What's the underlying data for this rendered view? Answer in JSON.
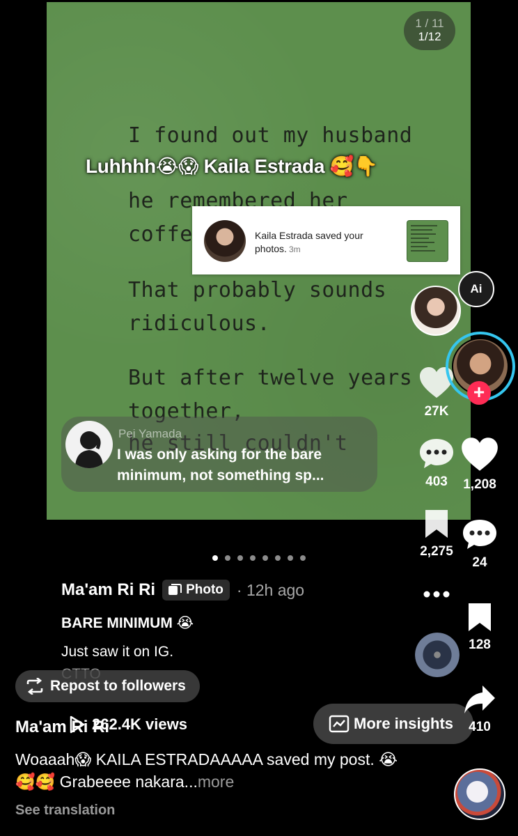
{
  "post": {
    "page_counter_old": "1 / 11",
    "page_counter": "1/12",
    "image_text_lines": [
      "I found out my husband",
      "he remembered her",
      "coffee",
      "That probably sounds",
      "ridiculous.",
      "But after twelve years",
      "together,",
      "he still couldn't"
    ],
    "overlay_caption": "Luhhhh😭😱 Kaila Estrada 🥰👇"
  },
  "notification": {
    "text": "Kaila Estrada saved your photos.",
    "time": "3m"
  },
  "comment_bubble": {
    "author": "Pei Yamada",
    "text": "I was only asking for the bare minimum, not something sp..."
  },
  "carousel": {
    "count": 8,
    "active_index": 0
  },
  "author": {
    "name": "Ma'am Ri Ri",
    "badge": "Photo",
    "time": "· 12h ago"
  },
  "caption": {
    "title": "BARE MINIMUM 😭",
    "line2": "Just saw it on IG.",
    "line3": "CTTO"
  },
  "repost_button": "Repost to followers",
  "views": "262.4K views",
  "insights_button": "More insights",
  "repost_comment": {
    "author": "Ma'am Ri Ri",
    "text": "Woaaah😱 KAILA ESTRADAAAAA saved my post. 😭🥰🥰 Grabeeee nakara...",
    "more": "more",
    "see_translation": "See translation"
  },
  "rail1": {
    "likes": "27K",
    "comments": "403",
    "saves": "2,275"
  },
  "rail2": {
    "likes": "1,208",
    "comments": "24",
    "saves": "128",
    "shares": "410"
  },
  "icons": {
    "ai": "Ai",
    "follow": "+"
  }
}
